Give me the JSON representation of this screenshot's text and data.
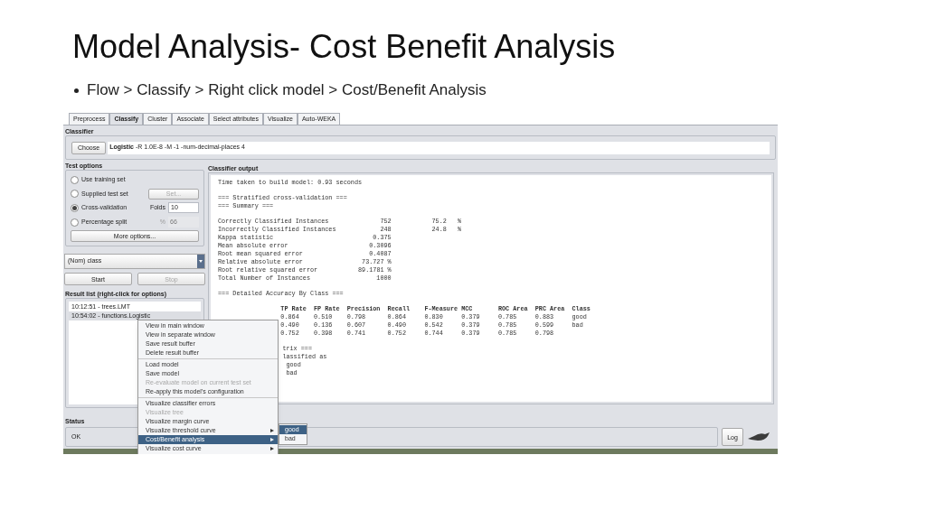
{
  "slide": {
    "title": "Model Analysis- Cost Benefit Analysis",
    "bullet": "Flow > Classify > Right click model > Cost/Benefit Analysis"
  },
  "tabs": [
    {
      "label": "Preprocess",
      "selected": false
    },
    {
      "label": "Classify",
      "selected": true
    },
    {
      "label": "Cluster",
      "selected": false
    },
    {
      "label": "Associate",
      "selected": false
    },
    {
      "label": "Select attributes",
      "selected": false
    },
    {
      "label": "Visualize",
      "selected": false
    },
    {
      "label": "Auto-WEKA",
      "selected": false
    }
  ],
  "classifier": {
    "heading": "Classifier",
    "button": "Choose",
    "name": "Logistic",
    "options": "-R 1.0E-8 -M -1 -num-decimal-places 4"
  },
  "test_options": {
    "heading": "Test options",
    "options": [
      {
        "label": "Use training set",
        "selected": false
      },
      {
        "label": "Supplied test set",
        "selected": false,
        "button": {
          "label": "Set...",
          "disabled": true
        }
      },
      {
        "label": "Cross-validation",
        "selected": true,
        "field": {
          "label": "Folds",
          "value": "10",
          "disabled": false
        }
      },
      {
        "label": "Percentage split",
        "selected": false,
        "field": {
          "label": "%",
          "value": "66",
          "disabled": true
        }
      }
    ],
    "more_button": "More options..."
  },
  "class_select": "(Nom) class",
  "start_button": {
    "label": "Start",
    "disabled": false
  },
  "stop_button": {
    "label": "Stop",
    "disabled": true
  },
  "result_list": {
    "heading": "Result list (right-click for options)",
    "items": [
      {
        "label": "10:12:51 - trees.LMT",
        "selected": false
      },
      {
        "label": "10:54:02 - functions.Logistic",
        "selected": true
      }
    ]
  },
  "output": {
    "heading": "Classifier output",
    "time_line": "Time taken to build model: 0.93 seconds",
    "intro": [
      "=== Stratified cross-validation ===",
      "=== Summary ==="
    ],
    "summary": [
      {
        "label": "Correctly Classified Instances",
        "value": "752",
        "percent": "75.2",
        "unit": "%"
      },
      {
        "label": "Incorrectly Classified Instances",
        "value": "248",
        "percent": "24.8",
        "unit": "%"
      },
      {
        "label": "Kappa statistic",
        "value": "0.375"
      },
      {
        "label": "Mean absolute error",
        "value": "0.3096"
      },
      {
        "label": "Root mean squared error",
        "value": "0.4087"
      },
      {
        "label": "Relative absolute error",
        "value": "73.727 %"
      },
      {
        "label": "Root relative squared error",
        "value": "89.1781 %"
      },
      {
        "label": "Total Number of Instances",
        "value": "1000"
      }
    ],
    "accuracy_heading": "=== Detailed Accuracy By Class ===",
    "accuracy_columns": [
      "TP Rate",
      "FP Rate",
      "Precision",
      "Recall",
      "F-Measure",
      "MCC",
      "ROC Area",
      "PRC Area",
      "Class"
    ],
    "accuracy_rows": [
      [
        "0.864",
        "0.510",
        "0.798",
        "0.864",
        "0.830",
        "0.379",
        "0.785",
        "0.883",
        "good"
      ],
      [
        "0.490",
        "0.136",
        "0.607",
        "0.490",
        "0.542",
        "0.379",
        "0.785",
        "0.599",
        "bad"
      ],
      [
        "0.752",
        "0.398",
        "0.741",
        "0.752",
        "0.744",
        "0.379",
        "0.785",
        "0.798"
      ]
    ],
    "matrix_lines": [
      "trix ===",
      "lassified as",
      " good",
      " bad"
    ]
  },
  "status": {
    "heading": "Status",
    "text": "OK",
    "log_button": "Log"
  },
  "context_menu": {
    "groups": [
      [
        {
          "label": "View in main window",
          "disabled": false,
          "selected": false,
          "submenu": false
        },
        {
          "label": "View in separate window",
          "disabled": false,
          "selected": false,
          "submenu": false
        },
        {
          "label": "Save result buffer",
          "disabled": false,
          "selected": false,
          "submenu": false
        },
        {
          "label": "Delete result buffer",
          "disabled": false,
          "selected": false,
          "submenu": false
        }
      ],
      [
        {
          "label": "Load model",
          "disabled": false,
          "selected": false,
          "submenu": false
        },
        {
          "label": "Save model",
          "disabled": false,
          "selected": false,
          "submenu": false
        },
        {
          "label": "Re-evaluate model on current test set",
          "disabled": true,
          "selected": false,
          "submenu": false
        },
        {
          "label": "Re-apply this model's configuration",
          "disabled": false,
          "selected": false,
          "submenu": false
        }
      ],
      [
        {
          "label": "Visualize classifier errors",
          "disabled": false,
          "selected": false,
          "submenu": false
        },
        {
          "label": "Visualize tree",
          "disabled": true,
          "selected": false,
          "submenu": false
        },
        {
          "label": "Visualize margin curve",
          "disabled": false,
          "selected": false,
          "submenu": false
        },
        {
          "label": "Visualize threshold curve",
          "disabled": false,
          "selected": false,
          "submenu": true
        },
        {
          "label": "Cost/Benefit analysis",
          "disabled": false,
          "selected": true,
          "submenu": true
        },
        {
          "label": "Visualize cost curve",
          "disabled": false,
          "selected": false,
          "submenu": true
        }
      ]
    ],
    "submenu": [
      {
        "label": "good",
        "selected": true
      },
      {
        "label": "bad",
        "selected": false
      }
    ]
  }
}
